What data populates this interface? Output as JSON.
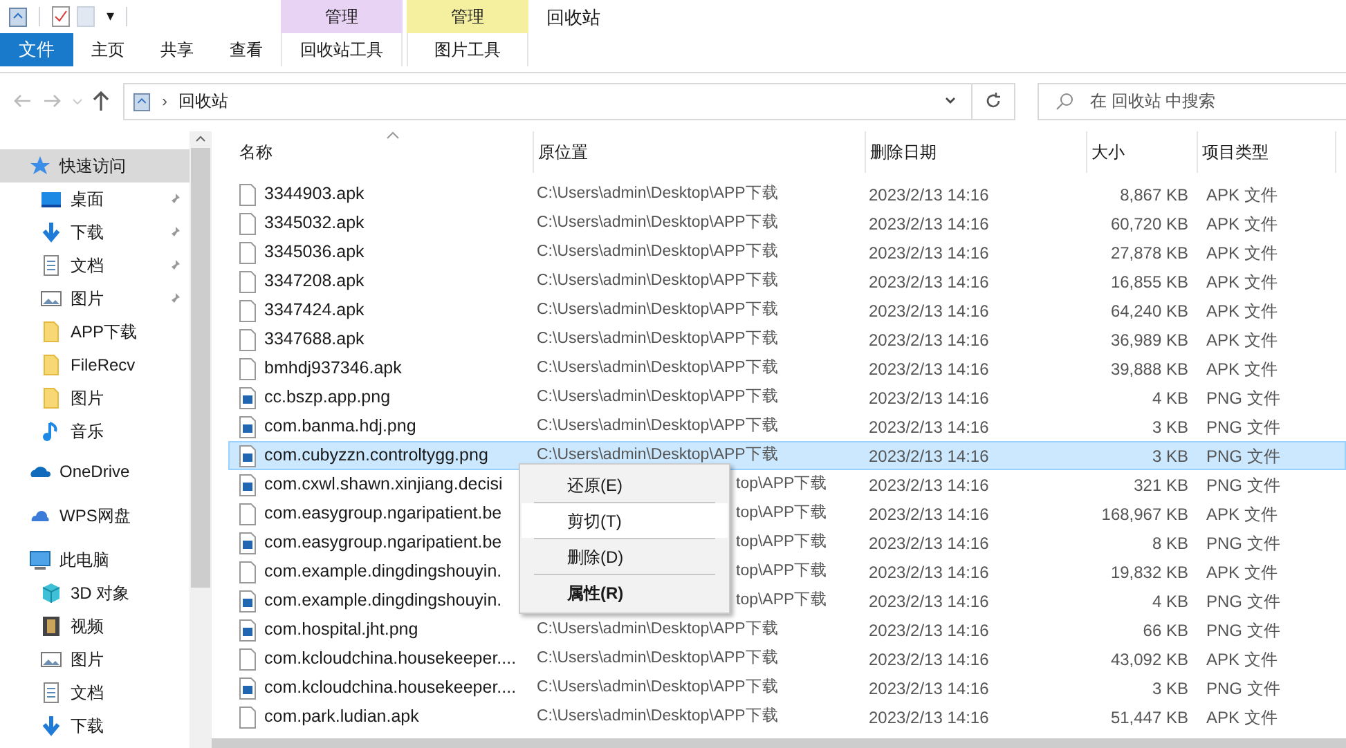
{
  "quick_access_toolbar": {
    "dropdown": "▾"
  },
  "ribbon": {
    "tabs": [
      {
        "label": "文件",
        "selected": true,
        "kind": "file"
      },
      {
        "label": "主页",
        "selected": false,
        "kind": "plain"
      },
      {
        "label": "共享",
        "selected": false,
        "kind": "plain"
      },
      {
        "label": "查看",
        "selected": false,
        "kind": "plain"
      },
      {
        "label": "回收站工具",
        "selected": false,
        "kind": "context",
        "group": "管理",
        "color": "#e8d3f5"
      },
      {
        "label": "图片工具",
        "selected": false,
        "kind": "context",
        "group": "管理",
        "color": "#f5f0a0"
      }
    ],
    "window_title": "回收站"
  },
  "address_bar": {
    "path": "回收站",
    "separator": "›"
  },
  "search": {
    "placeholder": "在 回收站 中搜索"
  },
  "sidebar": {
    "items": [
      {
        "label": "快速访问",
        "kind": "star",
        "selected": true,
        "children": [
          {
            "label": "桌面",
            "kind": "desktop",
            "pinned": true,
            "selected": false
          },
          {
            "label": "下载",
            "kind": "download",
            "pinned": true,
            "selected": false
          },
          {
            "label": "文档",
            "kind": "doc",
            "pinned": true,
            "selected": false
          },
          {
            "label": "图片",
            "kind": "image",
            "pinned": true,
            "selected": false
          },
          {
            "label": "APP下载",
            "kind": "folder",
            "pinned": false,
            "selected": false
          },
          {
            "label": "FileRecv",
            "kind": "folder",
            "pinned": false,
            "selected": false
          },
          {
            "label": "图片",
            "kind": "folder",
            "pinned": false,
            "selected": false
          },
          {
            "label": "音乐",
            "kind": "music",
            "pinned": false,
            "selected": false
          }
        ]
      },
      {
        "label": "OneDrive",
        "kind": "cloud",
        "selected": false
      },
      {
        "label": "WPS网盘",
        "kind": "cloud2",
        "selected": false
      },
      {
        "label": "此电脑",
        "kind": "pc",
        "selected": false,
        "children": [
          {
            "label": "3D 对象",
            "kind": "cube",
            "selected": false
          },
          {
            "label": "视频",
            "kind": "video",
            "selected": false
          },
          {
            "label": "图片",
            "kind": "image",
            "selected": false
          },
          {
            "label": "文档",
            "kind": "doc",
            "selected": false
          },
          {
            "label": "下载",
            "kind": "download",
            "selected": false
          }
        ]
      }
    ]
  },
  "table": {
    "columns": [
      "名称",
      "原位置",
      "删除日期",
      "大小",
      "项目类型"
    ],
    "rows": [
      {
        "kind": "file",
        "name": "3344903.apk",
        "location": "C:\\Users\\admin\\Desktop\\APP下载",
        "date": "2023/2/13 14:16",
        "size": "8,867 KB",
        "type": "APK 文件",
        "selected": false
      },
      {
        "kind": "file",
        "name": "3345032.apk",
        "location": "C:\\Users\\admin\\Desktop\\APP下载",
        "date": "2023/2/13 14:16",
        "size": "60,720 KB",
        "type": "APK 文件",
        "selected": false
      },
      {
        "kind": "file",
        "name": "3345036.apk",
        "location": "C:\\Users\\admin\\Desktop\\APP下载",
        "date": "2023/2/13 14:16",
        "size": "27,878 KB",
        "type": "APK 文件",
        "selected": false
      },
      {
        "kind": "file",
        "name": "3347208.apk",
        "location": "C:\\Users\\admin\\Desktop\\APP下载",
        "date": "2023/2/13 14:16",
        "size": "16,855 KB",
        "type": "APK 文件",
        "selected": false
      },
      {
        "kind": "file",
        "name": "3347424.apk",
        "location": "C:\\Users\\admin\\Desktop\\APP下载",
        "date": "2023/2/13 14:16",
        "size": "64,240 KB",
        "type": "APK 文件",
        "selected": false
      },
      {
        "kind": "file",
        "name": "3347688.apk",
        "location": "C:\\Users\\admin\\Desktop\\APP下载",
        "date": "2023/2/13 14:16",
        "size": "36,989 KB",
        "type": "APK 文件",
        "selected": false
      },
      {
        "kind": "file",
        "name": "bmhdj937346.apk",
        "location": "C:\\Users\\admin\\Desktop\\APP下载",
        "date": "2023/2/13 14:16",
        "size": "39,888 KB",
        "type": "APK 文件",
        "selected": false
      },
      {
        "kind": "image",
        "name": "cc.bszp.app.png",
        "location": "C:\\Users\\admin\\Desktop\\APP下载",
        "date": "2023/2/13 14:16",
        "size": "4 KB",
        "type": "PNG 文件",
        "selected": false
      },
      {
        "kind": "image",
        "name": "com.banma.hdj.png",
        "location": "C:\\Users\\admin\\Desktop\\APP下载",
        "date": "2023/2/13 14:16",
        "size": "3 KB",
        "type": "PNG 文件",
        "selected": false
      },
      {
        "kind": "image",
        "name": "com.cubyzzn.controltygg.png",
        "location": "C:\\Users\\admin\\Desktop\\APP下载",
        "date": "2023/2/13 14:16",
        "size": "3 KB",
        "type": "PNG 文件",
        "selected": true
      },
      {
        "kind": "image",
        "name": "com.cxwl.shawn.xinjiang.decisi",
        "location": "top\\APP下载",
        "date": "2023/2/13 14:16",
        "size": "321 KB",
        "type": "PNG 文件",
        "selected": false
      },
      {
        "kind": "file",
        "name": "com.easygroup.ngaripatient.be",
        "location": "top\\APP下载",
        "date": "2023/2/13 14:16",
        "size": "168,967 KB",
        "type": "APK 文件",
        "selected": false
      },
      {
        "kind": "image",
        "name": "com.easygroup.ngaripatient.be",
        "location": "top\\APP下载",
        "date": "2023/2/13 14:16",
        "size": "8 KB",
        "type": "PNG 文件",
        "selected": false
      },
      {
        "kind": "file",
        "name": "com.example.dingdingshouyin.",
        "location": "top\\APP下载",
        "date": "2023/2/13 14:16",
        "size": "19,832 KB",
        "type": "APK 文件",
        "selected": false
      },
      {
        "kind": "image",
        "name": "com.example.dingdingshouyin.",
        "location": "top\\APP下载",
        "date": "2023/2/13 14:16",
        "size": "4 KB",
        "type": "PNG 文件",
        "selected": false
      },
      {
        "kind": "image",
        "name": "com.hospital.jht.png",
        "location": "C:\\Users\\admin\\Desktop\\APP下载",
        "date": "2023/2/13 14:16",
        "size": "66 KB",
        "type": "PNG 文件",
        "selected": false
      },
      {
        "kind": "file",
        "name": "com.kcloudchina.housekeeper....",
        "location": "C:\\Users\\admin\\Desktop\\APP下载",
        "date": "2023/2/13 14:16",
        "size": "43,092 KB",
        "type": "APK 文件",
        "selected": false
      },
      {
        "kind": "image",
        "name": "com.kcloudchina.housekeeper....",
        "location": "C:\\Users\\admin\\Desktop\\APP下载",
        "date": "2023/2/13 14:16",
        "size": "3 KB",
        "type": "PNG 文件",
        "selected": false
      },
      {
        "kind": "file",
        "name": "com.park.ludian.apk",
        "location": "C:\\Users\\admin\\Desktop\\APP下载",
        "date": "2023/2/13 14:16",
        "size": "51,447 KB",
        "type": "APK 文件",
        "selected": false
      }
    ]
  },
  "context_menu": {
    "items": [
      {
        "label": "还原(E)",
        "bold": false,
        "hovered": false
      },
      {
        "label": "剪切(T)",
        "bold": false,
        "hovered": true
      },
      {
        "label": "删除(D)",
        "bold": false,
        "hovered": false
      },
      {
        "label": "属性(R)",
        "bold": true,
        "hovered": false
      }
    ]
  }
}
